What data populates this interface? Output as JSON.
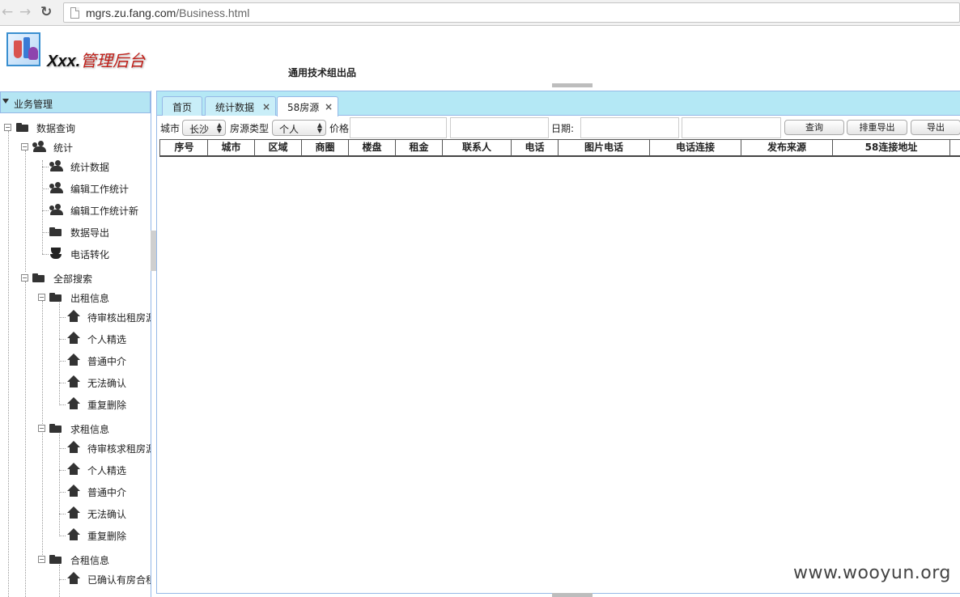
{
  "browser": {
    "url_host": "mgrs.zu.fang.com",
    "url_path": "/Business.html"
  },
  "header": {
    "title_prefix": "Xxx.",
    "title": "管理后台",
    "subtitle": "通用技术组出品"
  },
  "sidebar": {
    "panel_title": "业务管理",
    "tree": {
      "data_query": "数据查询",
      "stats": "统计",
      "stats_items": [
        "统计数据",
        "编辑工作统计",
        "编辑工作统计新",
        "数据导出",
        "电话转化"
      ],
      "all_search": "全部搜索",
      "rent_out": "出租信息",
      "rent_out_items": [
        "待审核出租房源",
        "个人精选",
        "普通中介",
        "无法确认",
        "重复删除"
      ],
      "rent_seek": "求租信息",
      "rent_seek_items": [
        "待审核求租房源",
        "个人精选",
        "普通中介",
        "无法确认",
        "重复删除"
      ],
      "shared_rent": "合租信息",
      "shared_rent_items": [
        "已确认有房合租"
      ]
    }
  },
  "tabs": [
    {
      "label": "首页",
      "closable": false
    },
    {
      "label": "统计数据",
      "closable": true
    },
    {
      "label": "58房源",
      "closable": true,
      "active": true
    }
  ],
  "filters": {
    "city_label": "城市",
    "city_value": "长沙",
    "type_label": "房源类型",
    "type_value": "个人",
    "price_label": "价格",
    "date_label": "日期:",
    "query_button": "查询",
    "dedupe_export_button": "排重导出",
    "export_button": "导出"
  },
  "grid": {
    "columns": [
      "序号",
      "城市",
      "区域",
      "商圈",
      "楼盘",
      "租金",
      "联系人",
      "电话",
      "图片电话",
      "电话连接",
      "发布来源",
      "58连接地址"
    ]
  },
  "watermark": "www.wooyun.org"
}
